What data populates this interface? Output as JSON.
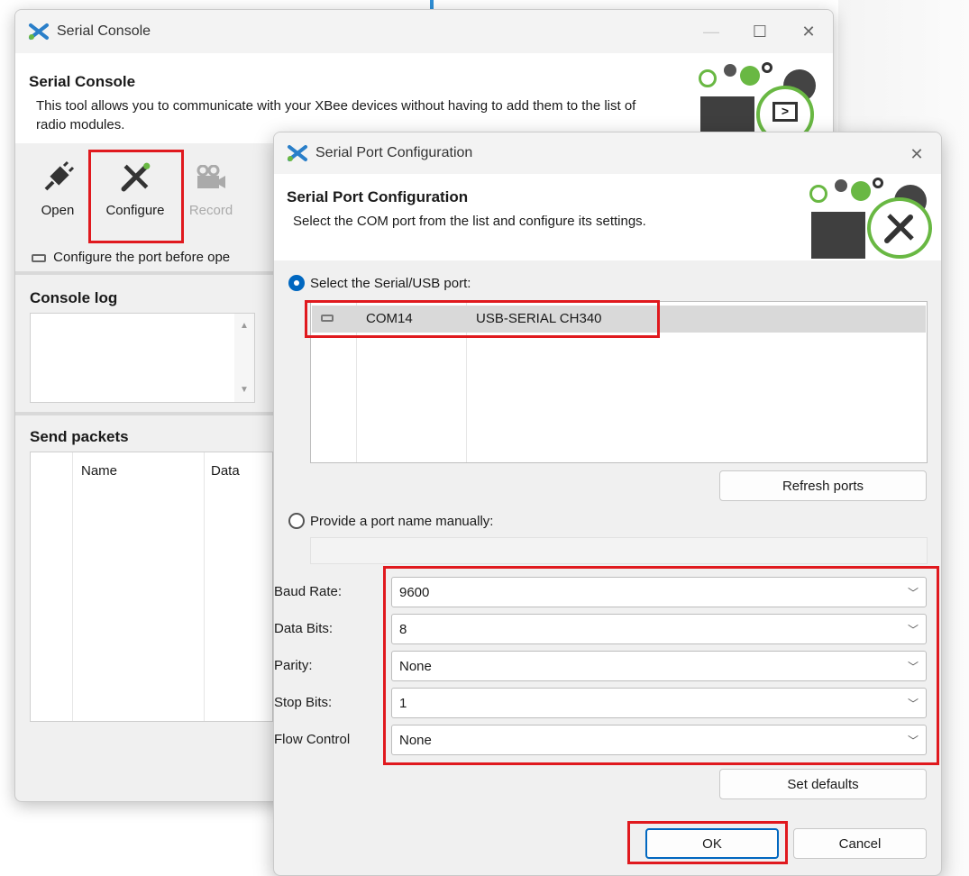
{
  "back_window": {
    "title": "Serial Console",
    "header_title": "Serial Console",
    "header_desc": "This tool allows you to communicate with your XBee devices without having to add them to the list of radio modules.",
    "toolbar": {
      "open_label": "Open",
      "configure_label": "Configure",
      "record_label": "Record"
    },
    "status_text": "Configure the port before ope",
    "console_log_title": "Console log",
    "send_packets_title": "Send packets",
    "packets_columns": [
      "Name",
      "Data"
    ]
  },
  "dialog": {
    "title": "Serial Port Configuration",
    "header_title": "Serial Port Configuration",
    "header_desc": "Select the COM port from the list and configure its settings.",
    "radio_select_label": "Select the Serial/USB port:",
    "ports": [
      {
        "name": "COM14",
        "description": "USB-SERIAL CH340",
        "selected": true
      }
    ],
    "refresh_label": "Refresh ports",
    "radio_manual_label": "Provide a port name manually:",
    "manual_port_value": "",
    "settings": {
      "baud_rate_label": "Baud Rate:",
      "baud_rate_value": "9600",
      "data_bits_label": "Data Bits:",
      "data_bits_value": "8",
      "parity_label": "Parity:",
      "parity_value": "None",
      "stop_bits_label": "Stop Bits:",
      "stop_bits_value": "1",
      "flow_control_label": "Flow Control",
      "flow_control_value": "None"
    },
    "set_defaults_label": "Set defaults",
    "ok_label": "OK",
    "cancel_label": "Cancel"
  },
  "colors": {
    "highlight": "#e0191e",
    "accent": "#0067c0",
    "logo_green": "#69b843"
  }
}
